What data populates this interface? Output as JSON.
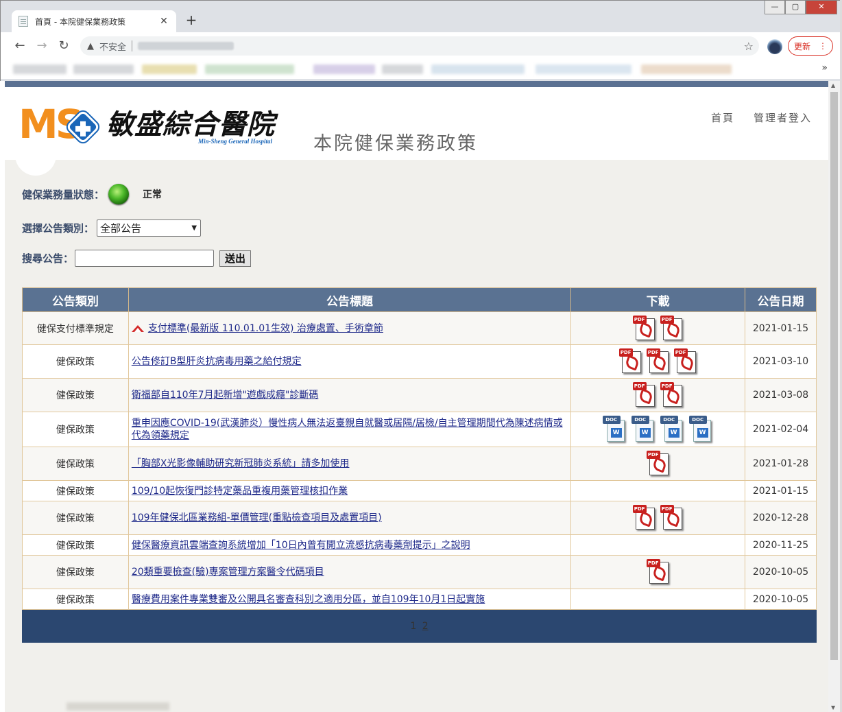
{
  "browser": {
    "tab_title": "首頁 - 本院健保業務政策",
    "close_glyph": "✕",
    "new_tab_glyph": "+",
    "back_glyph": "←",
    "forward_glyph": "→",
    "reload_glyph": "↻",
    "insecure_label": "不安全",
    "star_glyph": "☆",
    "update_label": "更新",
    "update_menu_glyph": "⋮",
    "bookmarks_more": "»",
    "min_glyph": "—",
    "max_glyph": "▢",
    "close_window_glyph": "✕"
  },
  "header": {
    "logo_letters": "MS",
    "hospital_name_cn": "敏盛綜合醫院",
    "hospital_name_en": "Min-Sheng General Hospital",
    "page_heading": "本院健保業務政策",
    "nav": [
      "首頁",
      "管理者登入"
    ]
  },
  "status": {
    "label": "健保業務量狀態：",
    "value": "正常",
    "light_color": "#4cb82a"
  },
  "category_filter": {
    "label": "選擇公告類別：",
    "selected": "全部公告"
  },
  "search": {
    "label": "搜尋公告：",
    "value": "",
    "button": "送出"
  },
  "table": {
    "headers": [
      "公告類別",
      "公告標題",
      "下載",
      "公告日期"
    ],
    "rows": [
      {
        "category": "健保支付標準規定",
        "title": "支付標準(最新版 110.01.01生效) 治療處置、手術章節",
        "is_new": true,
        "files": [
          "pdf",
          "pdf"
        ],
        "date": "2021-01-15"
      },
      {
        "category": "健保政策",
        "title": "公告修訂B型肝炎抗病毒用藥之給付規定",
        "is_new": false,
        "files": [
          "pdf",
          "pdf",
          "pdf"
        ],
        "date": "2021-03-10"
      },
      {
        "category": "健保政策",
        "title": "衛福部自110年7月起新增\"遊戲成癮\"診斷碼",
        "is_new": false,
        "files": [
          "pdf",
          "pdf"
        ],
        "date": "2021-03-08"
      },
      {
        "category": "健保政策",
        "title": "重申因應COVID-19(武漢肺炎）慢性病人無法返臺親自就醫或居隔/居檢/自主管理期間代為陳述病情或代為領藥規定",
        "is_new": false,
        "files": [
          "doc",
          "doc",
          "doc",
          "doc"
        ],
        "date": "2021-02-04"
      },
      {
        "category": "健保政策",
        "title": "「胸部X光影像輔助研究新冠肺炎系統」請多加使用",
        "is_new": false,
        "files": [
          "pdf"
        ],
        "date": "2021-01-28"
      },
      {
        "category": "健保政策",
        "title": "109/10起恢復門診特定藥品重複用藥管理核扣作業",
        "is_new": false,
        "files": [],
        "date": "2021-01-15"
      },
      {
        "category": "健保政策",
        "title": "109年健保北區業務組-單價管理(重點檢查項目及處置項目)",
        "is_new": false,
        "files": [
          "pdf",
          "pdf"
        ],
        "date": "2020-12-28"
      },
      {
        "category": "健保政策",
        "title": "健保醫療資訊雲端查詢系統增加「10日內曾有開立流感抗病毒藥劑提示」之說明",
        "is_new": false,
        "files": [],
        "date": "2020-11-25"
      },
      {
        "category": "健保政策",
        "title": "20類重要檢查(驗)專案管理方案醫令代碼項目",
        "is_new": false,
        "files": [
          "pdf"
        ],
        "date": "2020-10-05"
      },
      {
        "category": "健保政策",
        "title": "醫療費用案件專業雙審及公開具名審查科別之適用分區，並自109年10月1日起實施",
        "is_new": false,
        "files": [],
        "date": "2020-10-05"
      }
    ]
  },
  "pagination": {
    "current": "1",
    "pages": [
      "1",
      "2"
    ]
  },
  "colors": {
    "header_bar": "#5b7192",
    "table_header": "#5a7292",
    "pager_bg": "#2b4770",
    "link": "#1f2a8a",
    "logo_orange": "#f28f1e",
    "logo_blue": "#1a66b8"
  }
}
